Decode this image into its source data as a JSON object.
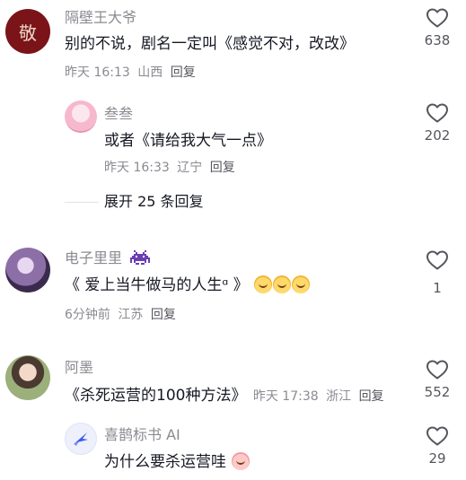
{
  "comments": [
    {
      "name": "隔壁王大爷",
      "text": "别的不说，剧名一定叫《感觉不对，改改》",
      "time": "昨天 16:13",
      "location": "山西",
      "reply": "回复",
      "likes": "638",
      "avatar_glyph": "敬",
      "avatar_color": "#7a1419"
    },
    {
      "name": "叁叁",
      "text": "或者《请给我大气一点》",
      "time": "昨天 16:33",
      "location": "辽宁",
      "reply": "回复",
      "likes": "202"
    },
    {
      "expand_label": "展开 25 条回复"
    },
    {
      "name": "电子里里",
      "name_icon": "pixel-invader-icon",
      "text": "《 爱上当牛做马的人生ᵅ 》",
      "time": "6分钟前",
      "location": "江苏",
      "reply": "回复",
      "likes": "1"
    },
    {
      "name": "阿墨",
      "text": "《杀死运营的100种方法》",
      "time": "昨天 17:38",
      "location": "浙江",
      "reply": "回复",
      "likes": "552"
    },
    {
      "name": "喜鹊标书 AI",
      "text": "为什么要杀运营哇",
      "likes": "29"
    }
  ],
  "colors": {
    "text": "#161823",
    "secondary": "#8a8b91",
    "brand_blue": "#3c5bf0"
  }
}
